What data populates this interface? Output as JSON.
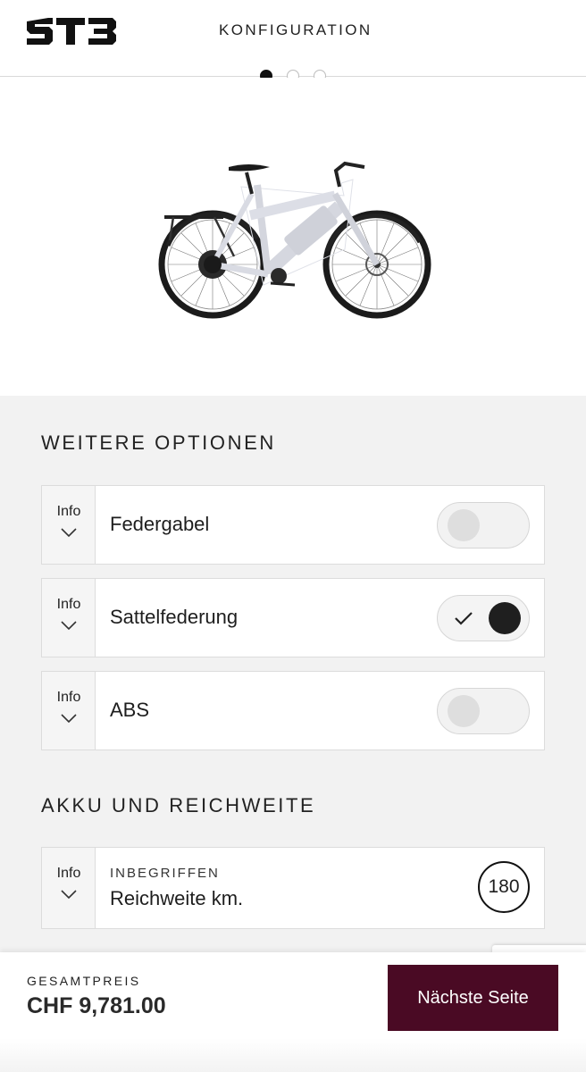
{
  "header": {
    "logo_text": "ST3",
    "title": "KONFIGURATION"
  },
  "carousel": {
    "total": 3,
    "active": 1
  },
  "sections": {
    "options_title": "WEITERE OPTIONEN",
    "battery_title": "AKKU UND REICHWEITE"
  },
  "options": [
    {
      "info": "Info",
      "label": "Federgabel",
      "enabled": false
    },
    {
      "info": "Info",
      "label": "Sattelfederung",
      "enabled": true
    },
    {
      "info": "Info",
      "label": "ABS",
      "enabled": false
    }
  ],
  "battery": {
    "info": "Info",
    "sublabel": "INBEGRIFFEN",
    "label": "Reichweite km.",
    "value": "180"
  },
  "footer": {
    "total_label": "GESAMTPREIS",
    "total_price": "CHF 9,781.00",
    "next_button": "Nächste Seite"
  },
  "colors": {
    "accent": "#4a0a24",
    "panel_bg": "#f2f2f2",
    "toggle_on": "#1f1f1f",
    "toggle_off": "#dedede"
  }
}
